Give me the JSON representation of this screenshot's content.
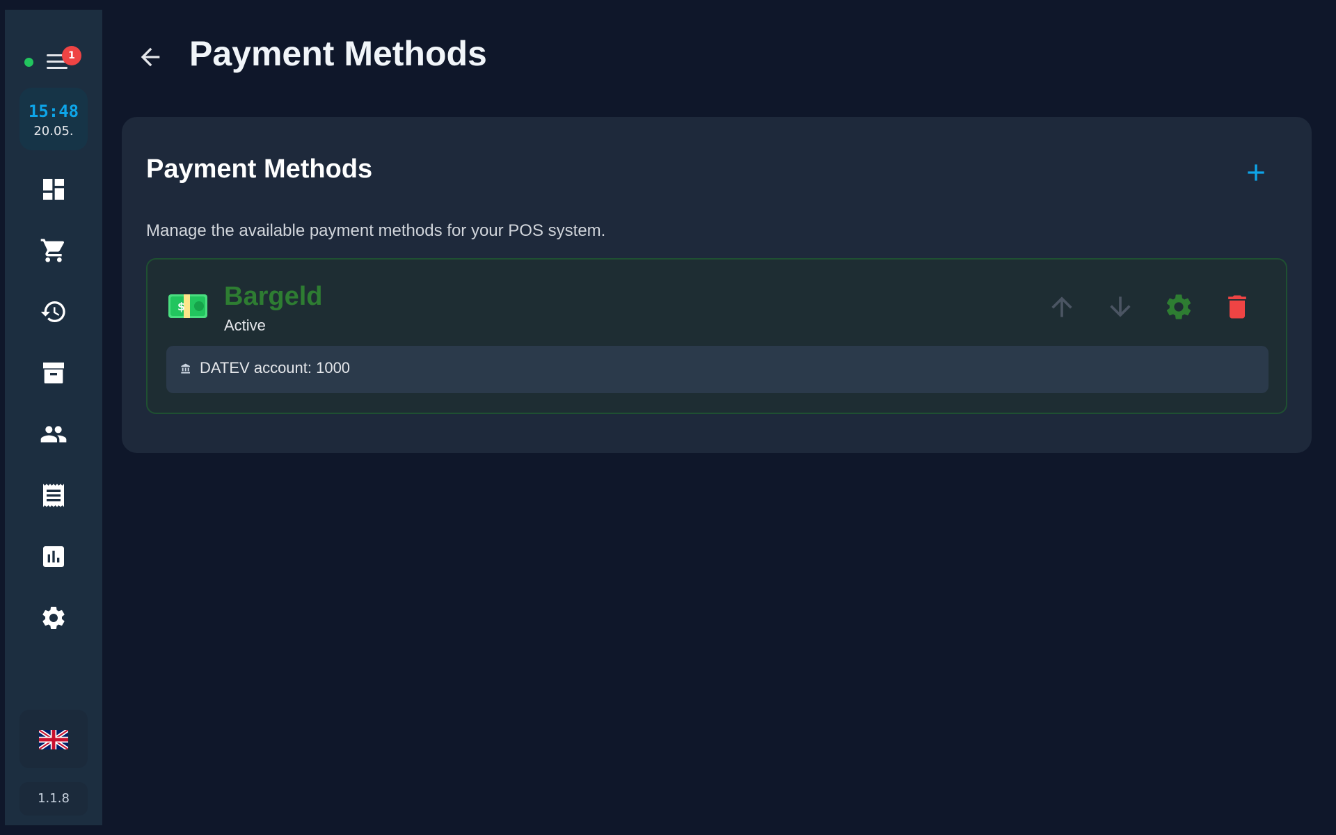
{
  "sidebar": {
    "notification_count": "1",
    "clock": {
      "time": "15:48",
      "date": "20.05."
    },
    "nav": [
      {
        "name": "dashboard",
        "icon": "dashboard-icon"
      },
      {
        "name": "cart",
        "icon": "cart-icon"
      },
      {
        "name": "history",
        "icon": "history-icon"
      },
      {
        "name": "archive",
        "icon": "archive-icon"
      },
      {
        "name": "customers",
        "icon": "people-icon"
      },
      {
        "name": "receipts",
        "icon": "receipt-icon"
      },
      {
        "name": "reports",
        "icon": "bar-chart-icon"
      },
      {
        "name": "settings",
        "icon": "gear-icon"
      }
    ],
    "language_icon": "uk-flag-icon",
    "version": "1.1.8"
  },
  "header": {
    "title": "Payment Methods"
  },
  "card": {
    "title": "Payment Methods",
    "description": "Manage the available payment methods for your POS system.",
    "methods": [
      {
        "icon": "money-bill-icon",
        "name": "Bargeld",
        "status": "Active",
        "detail": "DATEV account: 1000"
      }
    ]
  },
  "colors": {
    "background": "#0f172a",
    "sidebar": "#1c2e40",
    "card": "#1e293b",
    "accent": "#0ea5e9",
    "active_green": "#2e7d32",
    "delete_red": "#ef4444"
  }
}
